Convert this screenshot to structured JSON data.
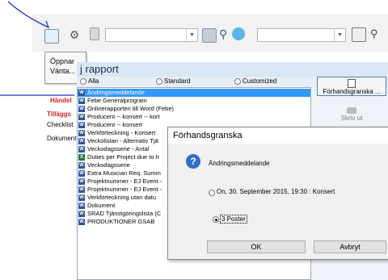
{
  "busy_popup": {
    "line1": "Öppnar",
    "line2": "Vänta..."
  },
  "sidebar": {
    "items": [
      "Händel",
      "Tilläggs",
      "Checklist",
      "Dokument"
    ]
  },
  "report_window": {
    "title": "j rapport",
    "filters": [
      {
        "label": "Alla",
        "selected": false
      },
      {
        "label": "Standard",
        "selected": false
      },
      {
        "label": "Customized",
        "selected": false
      }
    ],
    "reports": [
      {
        "label": "Ändringsmeddelande",
        "icon": "word-icon",
        "selected": true
      },
      {
        "label": "Febe Generalprogram",
        "icon": "word-icon"
      },
      {
        "label": "Onlinerapporten till Word (Febe)",
        "icon": "word-icon"
      },
      {
        "label": "Producent -- konsert -- kort",
        "icon": "word-icon"
      },
      {
        "label": "Producent -- konsert",
        "icon": "word-icon"
      },
      {
        "label": "Verkförteckning - Konsert",
        "icon": "word-icon"
      },
      {
        "label": "Veckolistan - Alternativ Tjä",
        "icon": "word-icon"
      },
      {
        "label": "Veckodagsserie - Antal",
        "icon": "word-icon"
      },
      {
        "label": "Duties per Project due to Ir",
        "icon": "excel-icon"
      },
      {
        "label": "Veckodagsserie",
        "icon": "word-icon"
      },
      {
        "label": "Extra Musician Req. Summ",
        "icon": "word-icon"
      },
      {
        "label": "Projektnummer - EJ Event -",
        "icon": "word-icon"
      },
      {
        "label": "Projektnummer - EJ Event -",
        "icon": "word-icon"
      },
      {
        "label": "Verkförteckning utan datu",
        "icon": "word-icon"
      },
      {
        "label": "Dokument",
        "icon": "word-icon"
      },
      {
        "label": "SRAD Tjänstgöringslista (C",
        "icon": "word-icon"
      },
      {
        "label": "PRODUKTIONER GSAB",
        "icon": "word-icon"
      }
    ],
    "preview_button": "Förhandsgranska ...",
    "print_button": "Skriv ut"
  },
  "dialog": {
    "title": "Förhandsgranska",
    "report_name": "Ändringsmeddelande",
    "option_date": "On, 30. September  2015, 19:30 : Konsert",
    "option_posts": "3 Poster",
    "ok_label": "OK",
    "cancel_label": "Avbryt"
  }
}
